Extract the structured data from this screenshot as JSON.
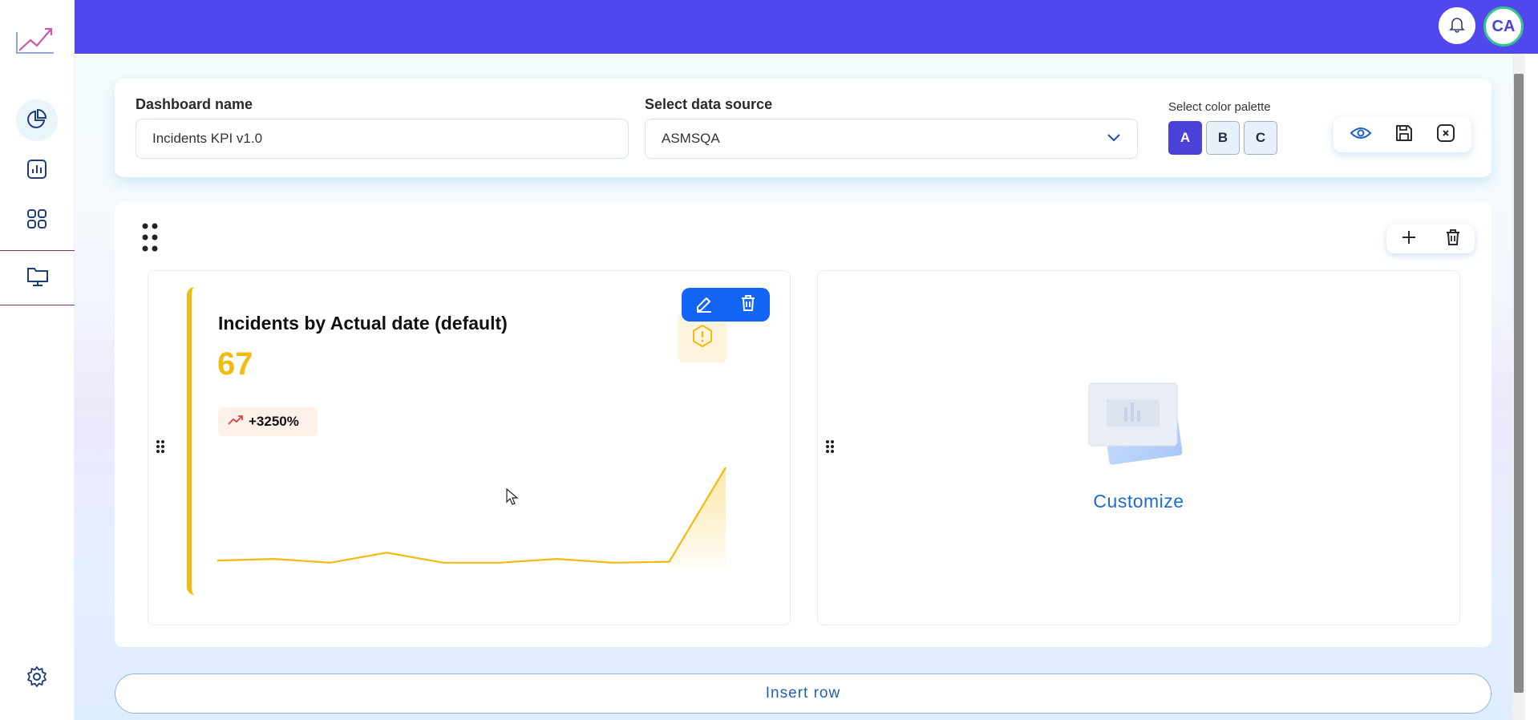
{
  "header": {
    "avatar_initials": "CA"
  },
  "settings": {
    "dashboard_name_label": "Dashboard name",
    "dashboard_name_value": "Incidents KPI v1.0",
    "data_source_label": "Select data source",
    "data_source_value": "ASMSQA",
    "palette_label": "Select color palette",
    "palette_options": [
      "A",
      "B",
      "C"
    ],
    "palette_selected": "A"
  },
  "widget_kpi": {
    "title": "Incidents by Actual date (default)",
    "value": "67",
    "trend": "+3250%",
    "accent_color": "#f2bb10",
    "sparkline_values": [
      3,
      4,
      1,
      8,
      1,
      1,
      4,
      1,
      2,
      62
    ]
  },
  "widget_empty": {
    "cta": "Customize"
  },
  "insert_row_label": "Insert row",
  "colors": {
    "primary": "#5147ef",
    "accent_blue": "#1264f4",
    "kpi_yellow": "#f2bb10"
  }
}
